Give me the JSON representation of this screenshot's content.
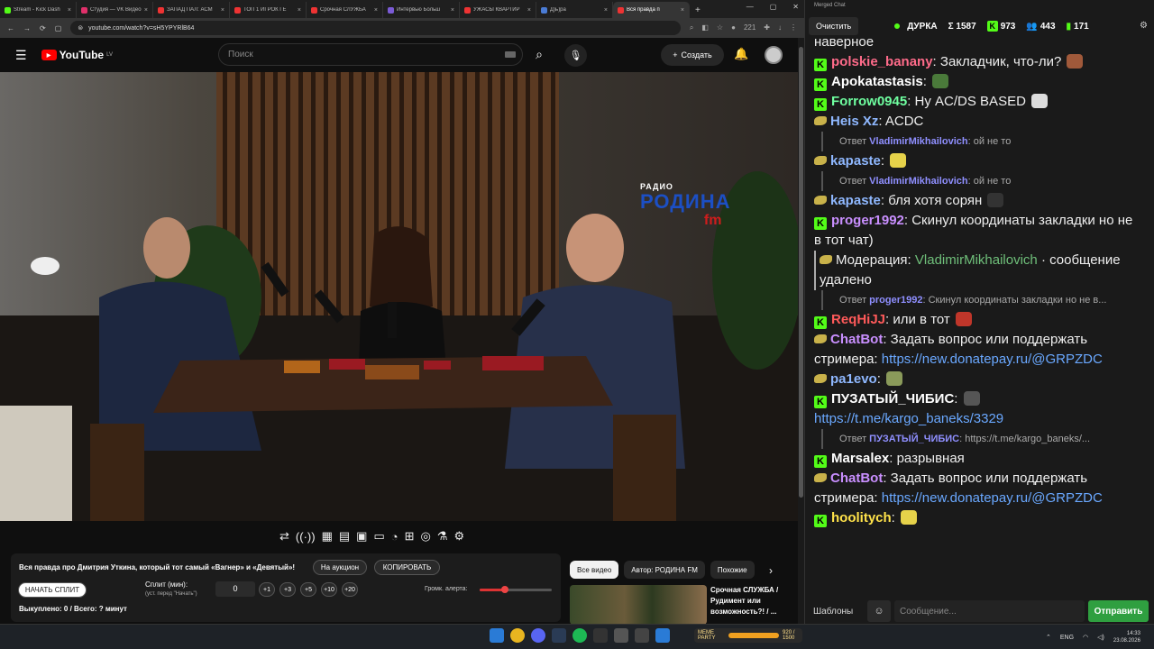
{
  "browser": {
    "tabs": [
      {
        "title": "Stream - Kick Dash",
        "color": "#53fc18"
      },
      {
        "title": "Студия — VK Видео",
        "color": "#e0306a"
      },
      {
        "title": "ЗАПАД ПАЛ: АСМ",
        "color": "#e33"
      },
      {
        "title": "ТОП 1 ИГРОК ГЕ",
        "color": "#e33"
      },
      {
        "title": "Срочная СЛУЖБА",
        "color": "#e33"
      },
      {
        "title": "Интервью Больш",
        "color": "#7b5bd6"
      },
      {
        "title": "УЖАСЫ КВАРТИР",
        "color": "#e33"
      },
      {
        "title": "Д)ь)ра",
        "color": "#4a7bd4"
      },
      {
        "title": "Вся правда п",
        "color": "#e33",
        "active": true
      }
    ],
    "url": "youtube.com/watch?v=sH5YPYRlB64",
    "badge": "221"
  },
  "youtube": {
    "logo": "YouTube",
    "region": "LV",
    "search_placeholder": "Поиск",
    "create_label": "Создать"
  },
  "video_overlay": {
    "radio": "РАДИО",
    "name": "РОДИНА",
    "fm": "fm"
  },
  "tools": [
    "⇄",
    "((·))",
    "▦",
    "▤",
    "▣",
    "▭",
    "◔",
    "⊞",
    "◎",
    "⚗",
    "⚙"
  ],
  "panel": {
    "title": "Вся правда про Дмитрия Уткина, который тот самый «Вагнер» и «Девятый»!",
    "auction_label": "На аукцион",
    "copy_label": "КОПИРОВАТЬ",
    "start_label": "НАЧАТЬ СПЛИТ",
    "split_label": "Сплит (мин):",
    "split_sub": "(уст. перед \"Начать\")",
    "split_value": "0",
    "increments": [
      "+1",
      "+3",
      "+5",
      "+10",
      "+20"
    ],
    "alert_label": "Громк. алерта:",
    "alert_volume": 0.35,
    "bought": "Выкуплено: 0 / Всего: ? минут"
  },
  "chips": [
    "Все видео",
    "Автор: РОДИНА FM",
    "Похожие"
  ],
  "recommendation": {
    "title": "Срочная СЛУЖБА / Рудимент или возможность?! / ..."
  },
  "chat": {
    "window_title": "Merged Chat",
    "clear_label": "Очистить",
    "channel": "ДУРКА",
    "stat_total": "Σ 1587",
    "stat_kick": "973",
    "stat_other": "443",
    "stat_third": "171",
    "templates_label": "Шаблоны",
    "input_placeholder": "Сообщение...",
    "send_label": "Отправить",
    "messages": [
      {
        "type": "text",
        "text": "наверное"
      },
      {
        "type": "msg",
        "src": "k",
        "user": "polskie_banany",
        "color": "#ff6b8a",
        "text": "Закладчик, что-ли?",
        "emote": "#a0593a"
      },
      {
        "type": "msg",
        "src": "k",
        "user": "Apokatastasis",
        "color": "#ffffff",
        "text": "",
        "emote": "#4a7a3a"
      },
      {
        "type": "msg",
        "src": "k",
        "user": "Forrow0945",
        "color": "#6fffa0",
        "text": "Ну AC/DS BASED",
        "emote": "#dddddd"
      },
      {
        "type": "msg",
        "src": "s",
        "user": "Heis Xz",
        "color": "#8fb8ff",
        "text": "ACDC"
      },
      {
        "type": "reply",
        "who": "Ответ",
        "ruser": "VladimirMikhailovich",
        "text": "ой не то"
      },
      {
        "type": "msg",
        "src": "s",
        "user": "kapaste",
        "color": "#8fb8ff",
        "text": "",
        "emote": "#e6d24a"
      },
      {
        "type": "reply",
        "who": "Ответ",
        "ruser": "VladimirMikhailovich",
        "text": "ой не то"
      },
      {
        "type": "msg",
        "src": "s",
        "user": "kapaste",
        "color": "#8fb8ff",
        "text": "бля хотя сорян",
        "emote": "#333333"
      },
      {
        "type": "msg",
        "src": "k",
        "user": "proger1992",
        "color": "#c98fff",
        "text": "Скинул координаты закладки но не в тот чат)"
      },
      {
        "type": "mod",
        "label": "Модерация:",
        "user": "VladimirMikhailovich",
        "text": "· сообщение удалено"
      },
      {
        "type": "reply",
        "who": "Ответ",
        "ruser": "proger1992",
        "text": "Скинул координаты закладки но не в..."
      },
      {
        "type": "msg",
        "src": "k",
        "user": "ReqHiJJ",
        "color": "#ff5a5a",
        "text": "или в тот",
        "emote": "#c0362a"
      },
      {
        "type": "msg",
        "src": "s",
        "user": "ChatBot",
        "color": "#c98fff",
        "text": "Задать вопрос или поддержать стримера:",
        "link": "https://new.donatepay.ru/@GRPZDC"
      },
      {
        "type": "msg",
        "src": "s",
        "user": "pa1evo",
        "color": "#8fb8ff",
        "text": "",
        "emote": "#8a9a5a"
      },
      {
        "type": "msg",
        "src": "k",
        "user": "ПУЗАТЫЙ_ЧИБИС",
        "color": "#ffffff",
        "text": "",
        "emote": "#555555",
        "link": "https://t.me/kargo_baneks/3329"
      },
      {
        "type": "reply",
        "who": "Ответ",
        "ruser": "ПУЗАТЫЙ_ЧИБИС",
        "text": "https://t.me/kargo_baneks/..."
      },
      {
        "type": "msg",
        "src": "k",
        "user": "Marsalex",
        "color": "#ffffff",
        "text": "разрывная"
      },
      {
        "type": "msg",
        "src": "s",
        "user": "ChatBot",
        "color": "#c98fff",
        "text": "Задать вопрос или поддержать стримера:",
        "link": "https://new.donatepay.ru/@GRPZDC"
      },
      {
        "type": "msg",
        "src": "k",
        "user": "hoolitych",
        "color": "#ffe24a",
        "text": "",
        "emote": "#e6d24a"
      }
    ]
  },
  "taskbar": {
    "lang": "ENG",
    "time": "14:33",
    "date": "23.08.2026",
    "meme_label": "MEME PARTY",
    "meme_value": "920 / 1500"
  }
}
